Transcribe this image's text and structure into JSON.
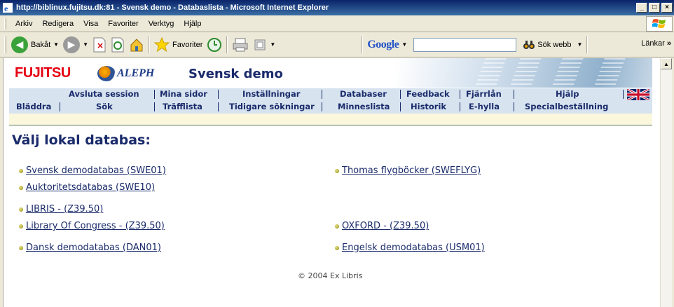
{
  "window": {
    "title": "http://biblinux.fujitsu.dk:81 - Svensk demo - Databaslista - Microsoft Internet Explorer"
  },
  "menubar": {
    "items": [
      "Arkiv",
      "Redigera",
      "Visa",
      "Favoriter",
      "Verktyg",
      "Hjälp"
    ]
  },
  "toolbar": {
    "back_label": "Bakåt",
    "favorites_label": "Favoriter",
    "google_label": "Google",
    "search_web_label": "Sök webb",
    "links_label": "Länkar",
    "search_value": ""
  },
  "page": {
    "brand": "FUJITSU",
    "aleph": "ALEPH",
    "site_title": "Svensk demo",
    "nav_row1": [
      "Avsluta session",
      "Mina sidor",
      "Inställningar",
      "Databaser",
      "Feedback",
      "Fjärrlån",
      "Hjälp"
    ],
    "nav_row2": [
      "Bläddra",
      "Sök",
      "Träfflista",
      "Tidigare sökningar",
      "Minneslista",
      "Historik",
      "E-hylla",
      "Specialbeställning"
    ],
    "heading": "Välj lokal databas:",
    "databases_left": [
      "Svensk demodatabas (SWE01)",
      "Auktoritetsdatabas (SWE10)",
      "LIBRIS - (Z39.50)",
      "Library Of Congress - (Z39.50)",
      "Dansk demodatabas (DAN01)"
    ],
    "databases_right": [
      "Thomas flygböcker (SWEFLYG)",
      "OXFORD - (Z39.50)",
      "Engelsk demodatabas (USM01)"
    ],
    "copyright": "© 2004 Ex Libris"
  },
  "colors": {
    "titlebar": "#0a246a",
    "link": "#1a2b6b",
    "nav_bg": "#d7e3ef",
    "brand_red": "#e60012"
  }
}
